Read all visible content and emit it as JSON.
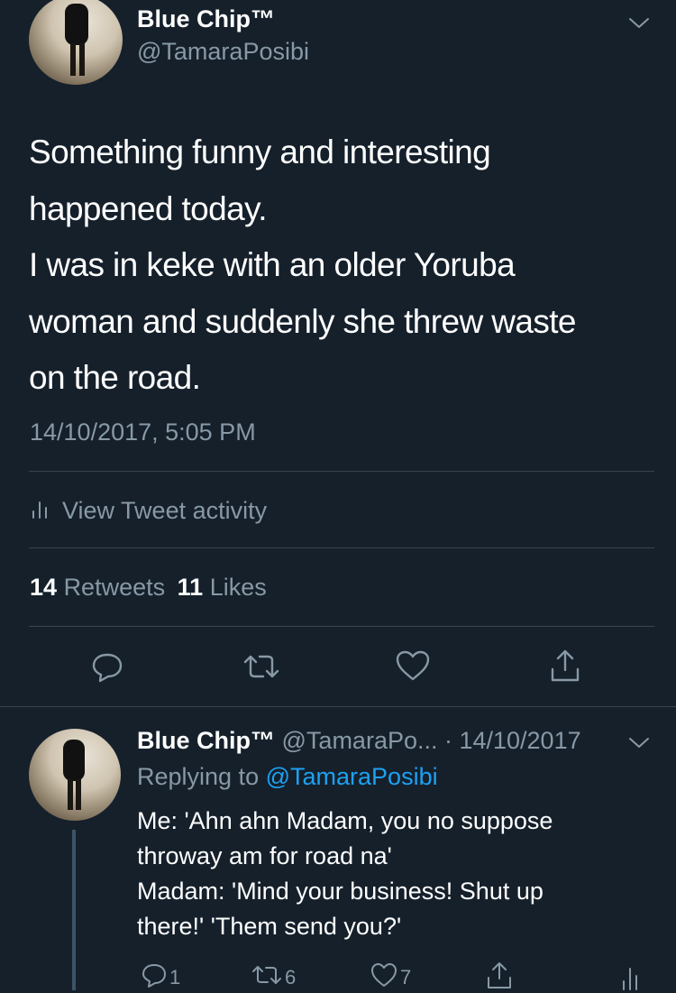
{
  "tweet": {
    "display_name": "Blue Chip™",
    "handle": "@TamaraPosibi",
    "text_lines": [
      "Something funny and interesting",
      "happened today.",
      "I was in keke with an older Yoruba",
      "woman and suddenly she threw waste",
      "on the road."
    ],
    "timestamp": "14/10/2017, 5:05 PM",
    "activity_label": "View Tweet activity",
    "retweets_count": "14",
    "retweets_label": "Retweets",
    "likes_count": "11",
    "likes_label": "Likes"
  },
  "reply": {
    "display_name": "Blue Chip™",
    "handle_date": "@TamaraPo... · 14/10/2017",
    "replying_prefix": "Replying to",
    "replying_handle": "@TamaraPosibi",
    "text_lines": [
      "Me: 'Ahn ahn Madam, you no suppose",
      "throway am for road na'",
      "Madam: 'Mind your business! Shut up",
      "there!' 'Them send you?'"
    ],
    "reply_count": "1",
    "retweet_count": "6",
    "like_count": "7"
  },
  "colors": {
    "background": "#15202b",
    "text": "#ffffff",
    "secondary": "#8899a6",
    "link": "#1da1f2",
    "divider": "#38444d"
  }
}
